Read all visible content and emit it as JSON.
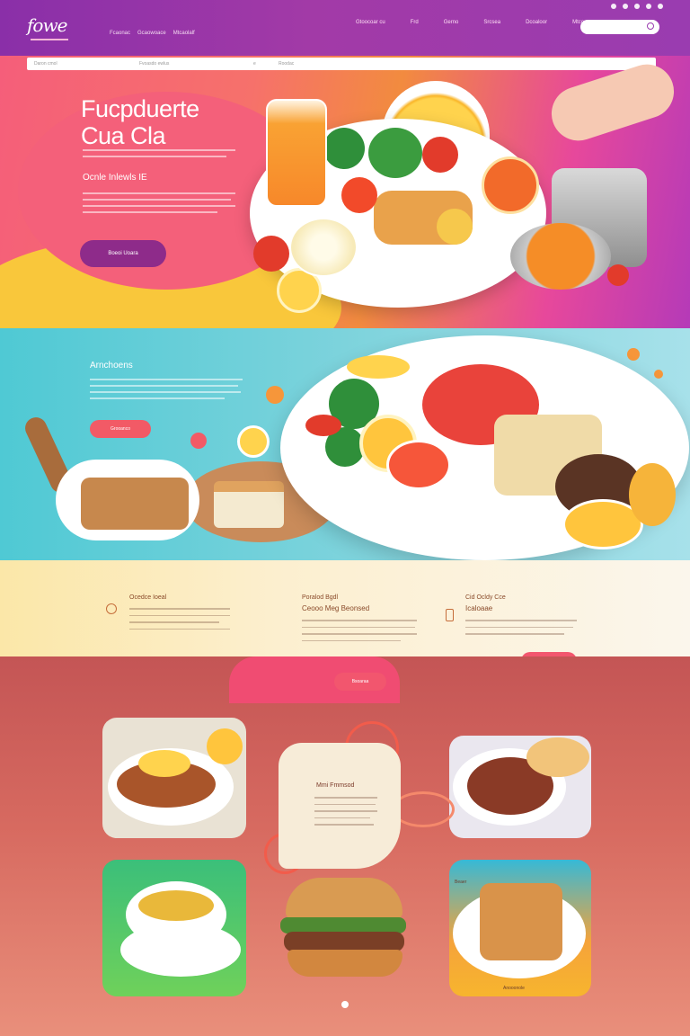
{
  "header": {
    "logo": "fowe",
    "top_links": [
      "Fcaonac",
      "Gcaowoace",
      "Mtcaolalf"
    ],
    "nav": [
      "Gtoocoar cu",
      "Frd",
      "Gerno",
      "Srcsea",
      "Dcoaloor",
      "Mtcor"
    ],
    "search_placeholder": ""
  },
  "hero": {
    "bar_items": [
      "Daron cmol",
      "Fvoasdo ewlus",
      "e",
      "Roodac"
    ],
    "title_line1": "Fucpduerte",
    "title_line2": "Cua Cla",
    "subtitle": "Ocnle Inlewls  IE",
    "button_label": "Boeoi Uoara"
  },
  "teal_section": {
    "title": "Arnchoens",
    "button_label": "Grooanco"
  },
  "features": [
    {
      "title": "Ocedce Ioeal",
      "subtitle": ""
    },
    {
      "title": "Poralod Bgdl",
      "subtitle": "Ceooo Meg Beonsed"
    },
    {
      "title": "Cid Ocldy Cce",
      "subtitle": "Icaloaae"
    }
  ],
  "features_buttons": [
    "Gcoeaa",
    "Bsoaraa"
  ],
  "gallery": {
    "center_title": "Mmi Fmmsod",
    "tile_labels": [
      "",
      "",
      "",
      "Beaer",
      "Anooonole"
    ]
  },
  "colors": {
    "brand_purple": "#9a3cb0",
    "hero_coral": "#f55e7a",
    "teal": "#4fc9d4",
    "accent_red": "#f2566e"
  }
}
